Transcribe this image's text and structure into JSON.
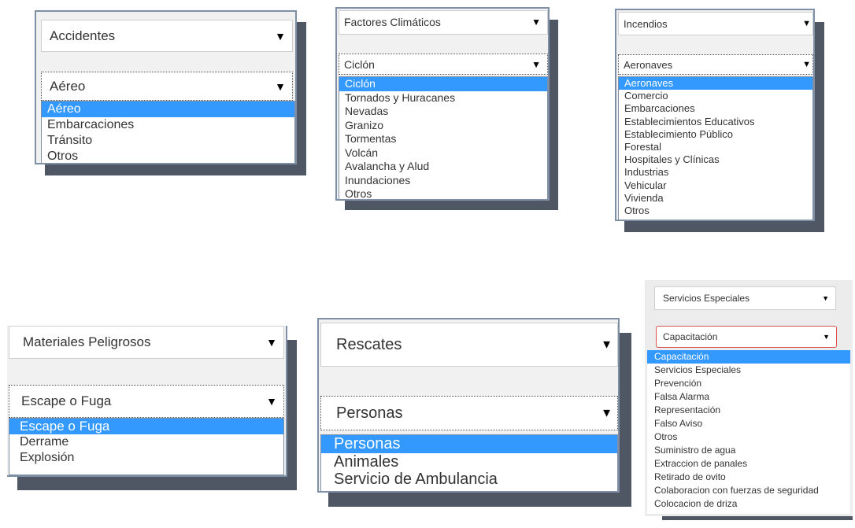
{
  "accidentes": {
    "category": "Accidentes",
    "selected": "Aéreo",
    "options": [
      "Aéreo",
      "Embarcaciones",
      "Tránsito",
      "Otros"
    ]
  },
  "climaticos": {
    "category": "Factores Climáticos",
    "selected": "Ciclón",
    "options": [
      "Ciclón",
      "Tornados y Huracanes",
      "Nevadas",
      "Granizo",
      "Tormentas",
      "Volcán",
      "Avalancha y Alud",
      "Inundaciones",
      "Otros"
    ]
  },
  "incendios": {
    "category": "Incendios",
    "selected": "Aeronaves",
    "options": [
      "Aeronaves",
      "Comercio",
      "Embarcaciones",
      "Establecimientos Educativos",
      "Establecimiento Público",
      "Forestal",
      "Hospitales y Clínicas",
      "Industrias",
      "Vehicular",
      "Vivienda",
      "Otros"
    ]
  },
  "materiales": {
    "category": "Materiales Peligrosos",
    "selected": "Escape o Fuga",
    "options": [
      "Escape o Fuga",
      "Derrame",
      "Explosión"
    ]
  },
  "rescates": {
    "category": "Rescates",
    "selected": "Personas",
    "options": [
      "Personas",
      "Animales",
      "Servicio de Ambulancia"
    ]
  },
  "servicios": {
    "category": "Servicios Especiales",
    "selected": "Capacitación",
    "options": [
      "Capacitación",
      "Servicios Especiales",
      "Prevención",
      "Falsa Alarma",
      "Representación",
      "Falso Aviso",
      "Otros",
      "Suministro de agua",
      "Extraccion de panales",
      "Retirado de ovito",
      "Colaboracion con fuerzas de seguridad",
      "Colocacion de driza"
    ]
  },
  "arrow_glyph": "▼",
  "colors": {
    "highlight": "#3399ff",
    "frame": "#7f8fa6",
    "shadow": "#4f5664",
    "focus_border": "#d9534f"
  }
}
